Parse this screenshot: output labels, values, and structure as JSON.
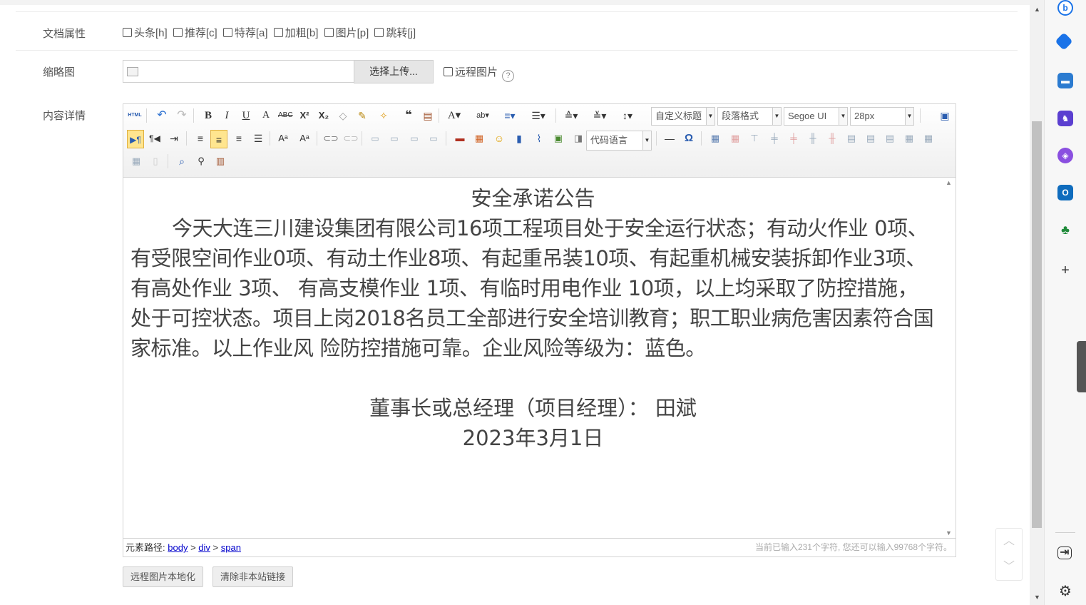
{
  "form": {
    "attrs_label": "文档属性",
    "attrs": [
      "头条[h]",
      "推荐[c]",
      "特荐[a]",
      "加粗[b]",
      "图片[p]",
      "跳转[j]"
    ],
    "thumb_label": "缩略图",
    "upload_button": "选择上传...",
    "remote_label": "远程图片",
    "help_glyph": "?",
    "content_label": "内容详情"
  },
  "editor": {
    "toolbar": {
      "html_label": "HTML",
      "title_combo": "自定义标题",
      "paragraph_combo": "段落格式",
      "font_combo": "Segoe UI",
      "size_combo": "28px",
      "code_combo": "代码语言"
    },
    "content": {
      "title": "安全承诺公告",
      "body": "今天大连三川建设集团有限公司16项工程项目处于安全运行状态；有动火作业 0项、有受限空间作业0项、有动土作业8项、有起重吊装10项、有起重机械安装拆卸作业3项、有高处作业 3项、 有高支模作业 1项、有临时用电作业 10项，以上均采取了防控措施，处于可控状态。项目上岗2018名员工全部进行安全培训教育；职工职业病危害因素符合国家标准。以上作业风 险防控措施可靠。企业风险等级为：蓝色。",
      "signature": "董事长或总经理（项目经理）：  田斌",
      "date": "2023年3月1日"
    },
    "status": {
      "path_label": "元素路径:",
      "path": [
        "body",
        "div",
        "span"
      ],
      "path_sep": ">",
      "count_text": "当前已输入231个字符, 您还可以输入99768个字符。"
    }
  },
  "buttons": {
    "localize_remote": "远程图片本地化",
    "clear_links": "清除非本站链接"
  },
  "colors": {
    "accent_blue": "#0b57d0",
    "highlight": "#ffe58f"
  }
}
